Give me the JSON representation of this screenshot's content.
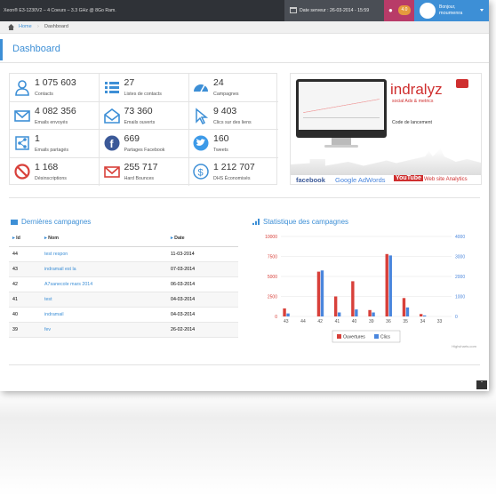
{
  "topbar": {
    "cpu": "Xeon® E3-1230V2 – 4 Coeurs – 3.3 GHz @ 8Go Ram.",
    "server_date": "Date serveur : 26-03-2014 - 15:59",
    "notif_count": "4.0",
    "greeting": "Bonjour,",
    "username": "moumenra"
  },
  "breadcrumb": {
    "home": "Home",
    "current": "Dashboard"
  },
  "page": {
    "title": "Dashboard"
  },
  "stats": [
    {
      "value": "1 075 603",
      "label": "Contacts",
      "icon": "user-icon"
    },
    {
      "value": "27",
      "label": "Listes de contacts",
      "icon": "list-icon"
    },
    {
      "value": "24",
      "label": "Campagnes",
      "icon": "dashboard-icon"
    },
    {
      "value": "4 082 356",
      "label": "Emails envoyés",
      "icon": "envelope-icon"
    },
    {
      "value": "73 360",
      "label": "Emails ouverts",
      "icon": "envelope-open-icon"
    },
    {
      "value": "9 403",
      "label": "Clics sur des liens",
      "icon": "cursor-icon"
    },
    {
      "value": "1",
      "label": "Emails partagés",
      "icon": "share-icon"
    },
    {
      "value": "669",
      "label": "Partages Facebook",
      "icon": "facebook-icon"
    },
    {
      "value": "160",
      "label": "Tweets",
      "icon": "twitter-icon"
    },
    {
      "value": "1 168",
      "label": "Désinscriptions",
      "icon": "ban-icon"
    },
    {
      "value": "255 717",
      "label": "Hard Bounces",
      "icon": "envelope-x-icon"
    },
    {
      "value": "1 212 707",
      "label": "DHS Économisés",
      "icon": "dollar-icon"
    }
  ],
  "ad": {
    "brand": "indralyz",
    "tagline": "social Ads & metrics",
    "code": "Code de lancement",
    "partners": [
      "facebook",
      "Google AdWords",
      "YouTube",
      "Web site Analytics"
    ]
  },
  "campaigns": {
    "title": "Dernières campagnes",
    "headers": [
      "Id",
      "Nom",
      "Date"
    ],
    "rows": [
      {
        "id": "44",
        "name": "test respon",
        "date": "11-03-2014"
      },
      {
        "id": "43",
        "name": "indramail est la",
        "date": "07-03-2014"
      },
      {
        "id": "42",
        "name": "A7sanecole mars 2014",
        "date": "06-03-2014"
      },
      {
        "id": "41",
        "name": "test",
        "date": "04-03-2014"
      },
      {
        "id": "40",
        "name": "indramail",
        "date": "04-03-2014"
      },
      {
        "id": "39",
        "name": "fev",
        "date": "26-02-2014"
      }
    ]
  },
  "chart_data": {
    "type": "bar",
    "title": "Statistique des campagnes",
    "categories": [
      "43",
      "44",
      "42",
      "41",
      "40",
      "39",
      "36",
      "35",
      "34",
      "33"
    ],
    "series": [
      {
        "name": "Ouvertures",
        "color": "#d8403a",
        "axis": "left",
        "values": [
          1000,
          0,
          5600,
          2500,
          4400,
          800,
          7800,
          2300,
          300,
          0
        ]
      },
      {
        "name": "Clics",
        "color": "#4a86dd",
        "axis": "right",
        "values": [
          150,
          0,
          2300,
          200,
          350,
          200,
          3050,
          450,
          50,
          0
        ]
      }
    ],
    "y_left": {
      "ticks": [
        "10000",
        "7500",
        "5000",
        "2500",
        "0"
      ],
      "max": 10000,
      "color": "#d8403a"
    },
    "y_right": {
      "ticks": [
        "4000",
        "3000",
        "2000",
        "1000",
        "0"
      ],
      "max": 4000,
      "color": "#4a86dd"
    },
    "credit": "Highcharts.com"
  }
}
